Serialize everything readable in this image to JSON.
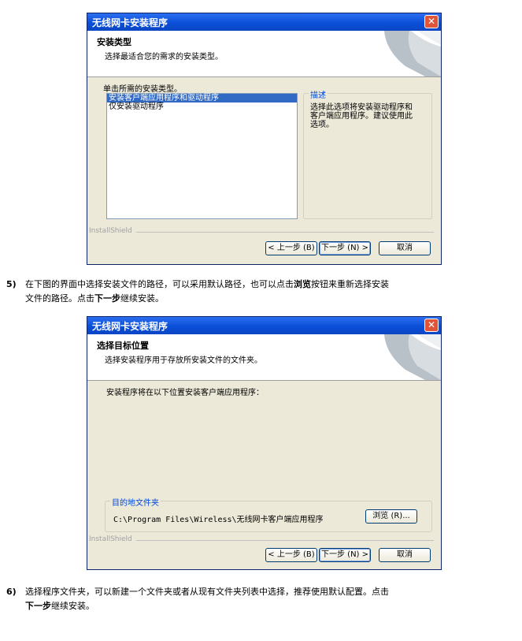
{
  "dialog1": {
    "title": "无线网卡安装程序",
    "close_glyph": "✕",
    "header_title": "安装类型",
    "header_subtitle": "选择最适合您的需求的安装类型。",
    "prompt": "单击所需的安装类型。",
    "options": [
      "安装客户端应用程序和驱动程序",
      "仅安装驱动程序"
    ],
    "selected_index": 0,
    "desc_title": "描述",
    "desc_text": [
      "选择此选项将安装驱动程序和",
      "客户端应用程序。建议使用此",
      "选项。"
    ],
    "installshield": "InstallShield",
    "back_label": "< 上一步 (B)",
    "next_label": "下一步 (N) >",
    "cancel_label": "取消"
  },
  "step5": {
    "number": "5)",
    "text_a": "在下图的界面中选择安装文件的路径，可以采用默认路径，也可以点击",
    "bold_a": "浏览",
    "text_b": "按钮来重新选择安装",
    "text_c": "文件的路径。点击",
    "bold_b": "下一步",
    "text_d": "继续安装。"
  },
  "dialog2": {
    "title": "无线网卡安装程序",
    "close_glyph": "✕",
    "header_title": "选择目标位置",
    "header_subtitle": "选择安装程序用于存放所安装文件的文件夹。",
    "prompt": "安装程序将在以下位置安装客户端应用程序：",
    "group_title": "目的地文件夹",
    "path": "C:\\Program Files\\Wireless\\无线网卡客户端应用程序",
    "browse_label": "浏览 (R)...",
    "installshield": "InstallShield",
    "back_label": "< 上一步 (B)",
    "next_label": "下一步 (N) >",
    "cancel_label": "取消"
  },
  "step6": {
    "number": "6)",
    "text_a": "选择程序文件夹，可以新建一个文件夹或者从现有文件夹列表中选择，推荐使用默认配置。点击",
    "bold_a": "下一步",
    "text_b": "继续安装。"
  }
}
